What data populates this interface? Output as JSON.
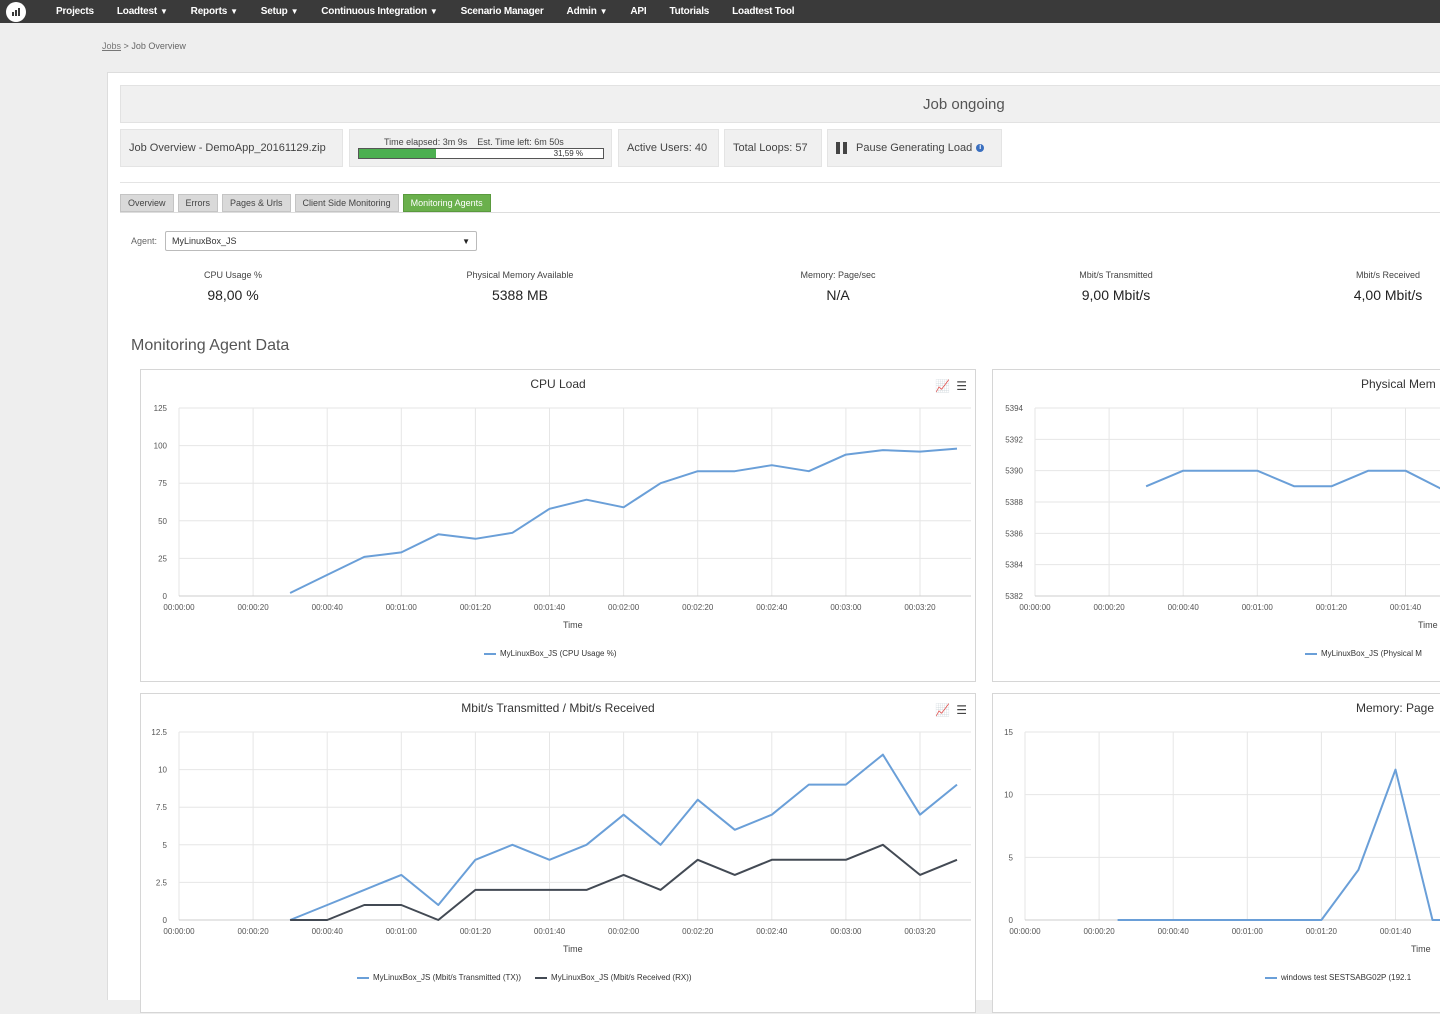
{
  "nav": {
    "items": [
      {
        "label": "Projects",
        "caret": false
      },
      {
        "label": "Loadtest",
        "caret": true
      },
      {
        "label": "Reports",
        "caret": true
      },
      {
        "label": "Setup",
        "caret": true
      },
      {
        "label": "Continuous Integration",
        "caret": true
      },
      {
        "label": "Scenario Manager",
        "caret": false
      },
      {
        "label": "Admin",
        "caret": true
      },
      {
        "label": "API",
        "caret": false
      },
      {
        "label": "Tutorials",
        "caret": false
      },
      {
        "label": "Loadtest Tool",
        "caret": false
      }
    ]
  },
  "breadcrumb": {
    "link": "Jobs",
    "separator": ">",
    "current": "Job Overview"
  },
  "status": "Job ongoing",
  "job": {
    "title": "Job Overview - DemoApp_20161129.zip",
    "elapsed": "Time elapsed: 3m 9s",
    "remaining": "Est. Time left: 6m 50s",
    "progress_percent": 31.59,
    "progress_label": "31,59 %",
    "active_users": "Active Users: 40",
    "total_loops": "Total Loops: 57",
    "pause_label": "Pause Generating Load",
    "info_glyph": "i"
  },
  "tabs": [
    {
      "label": "Overview",
      "active": false
    },
    {
      "label": "Errors",
      "active": false
    },
    {
      "label": "Pages & Urls",
      "active": false
    },
    {
      "label": "Client Side Monitoring",
      "active": false
    },
    {
      "label": "Monitoring Agents",
      "active": true
    }
  ],
  "agent": {
    "label": "Agent:",
    "selected": "MyLinuxBox_JS"
  },
  "stats": [
    {
      "label": "CPU Usage %",
      "value": "98,00 %"
    },
    {
      "label": "Physical Memory Available",
      "value": "5388 MB"
    },
    {
      "label": "Memory: Page/sec",
      "value": "N/A"
    },
    {
      "label": "Mbit/s Transmitted",
      "value": "9,00 Mbit/s"
    },
    {
      "label": "Mbit/s Received",
      "value": "4,00 Mbit/s"
    }
  ],
  "section_title": "Monitoring Agent Data",
  "colors": {
    "series1": "#6a9fd8",
    "series2": "#434a54",
    "progress": "#4caf50",
    "tab_active": "#6ab04c"
  },
  "chart_data": [
    {
      "type": "line",
      "title": "CPU Load",
      "xlabel": "Time",
      "x": [
        "00:00:00",
        "00:00:20",
        "00:00:40",
        "00:01:00",
        "00:01:20",
        "00:01:40",
        "00:02:00",
        "00:02:20",
        "00:02:40",
        "00:03:00",
        "00:03:20"
      ],
      "y_ticks": [
        "0",
        "25",
        "50",
        "75",
        "100",
        "125"
      ],
      "ylim": [
        0,
        125
      ],
      "series": [
        {
          "name": "MyLinuxBox_JS (CPU Usage %)",
          "color": "#6a9fd8",
          "points": [
            [
              30,
              2
            ],
            [
              40,
              14
            ],
            [
              50,
              26
            ],
            [
              60,
              29
            ],
            [
              70,
              41
            ],
            [
              80,
              38
            ],
            [
              90,
              42
            ],
            [
              100,
              58
            ],
            [
              110,
              64
            ],
            [
              120,
              59
            ],
            [
              130,
              75
            ],
            [
              140,
              83
            ],
            [
              150,
              83
            ],
            [
              160,
              87
            ],
            [
              170,
              83
            ],
            [
              180,
              94
            ],
            [
              190,
              97
            ],
            [
              200,
              96
            ],
            [
              210,
              98
            ]
          ]
        }
      ]
    },
    {
      "type": "line",
      "title": "Physical Mem",
      "xlabel": "Time",
      "x": [
        "00:00:00",
        "00:00:20",
        "00:00:40",
        "00:01:00",
        "00:01:20",
        "00:01:40"
      ],
      "y_ticks": [
        "5382",
        "5384",
        "5386",
        "5388",
        "5390",
        "5392",
        "5394"
      ],
      "ylim": [
        5382,
        5394
      ],
      "series": [
        {
          "name": "MyLinuxBox_JS (Physical M",
          "color": "#6a9fd8",
          "points": [
            [
              30,
              5389
            ],
            [
              40,
              5390
            ],
            [
              50,
              5390
            ],
            [
              60,
              5390
            ],
            [
              70,
              5389
            ],
            [
              80,
              5389
            ],
            [
              90,
              5390
            ],
            [
              100,
              5390
            ],
            [
              110,
              5388.8
            ]
          ]
        }
      ]
    },
    {
      "type": "line",
      "title": "Mbit/s Transmitted / Mbit/s Received",
      "xlabel": "Time",
      "x": [
        "00:00:00",
        "00:00:20",
        "00:00:40",
        "00:01:00",
        "00:01:20",
        "00:01:40",
        "00:02:00",
        "00:02:20",
        "00:02:40",
        "00:03:00",
        "00:03:20"
      ],
      "y_ticks": [
        "0",
        "2.5",
        "5",
        "7.5",
        "10",
        "12.5"
      ],
      "ylim": [
        0,
        12.5
      ],
      "series": [
        {
          "name": "MyLinuxBox_JS (Mbit/s Transmitted (TX))",
          "color": "#6a9fd8",
          "points": [
            [
              30,
              0
            ],
            [
              40,
              1
            ],
            [
              50,
              2
            ],
            [
              60,
              3
            ],
            [
              70,
              1
            ],
            [
              80,
              4
            ],
            [
              90,
              5
            ],
            [
              100,
              4
            ],
            [
              110,
              5
            ],
            [
              120,
              7
            ],
            [
              130,
              5
            ],
            [
              140,
              8
            ],
            [
              150,
              6
            ],
            [
              160,
              7
            ],
            [
              170,
              9
            ],
            [
              180,
              9
            ],
            [
              190,
              11
            ],
            [
              200,
              7
            ],
            [
              210,
              9
            ]
          ]
        },
        {
          "name": "MyLinuxBox_JS (Mbit/s Received (RX))",
          "color": "#434a54",
          "points": [
            [
              30,
              0
            ],
            [
              40,
              0
            ],
            [
              50,
              1
            ],
            [
              60,
              1
            ],
            [
              70,
              0
            ],
            [
              80,
              2
            ],
            [
              90,
              2
            ],
            [
              100,
              2
            ],
            [
              110,
              2
            ],
            [
              120,
              3
            ],
            [
              130,
              2
            ],
            [
              140,
              4
            ],
            [
              150,
              3
            ],
            [
              160,
              4
            ],
            [
              170,
              4
            ],
            [
              180,
              4
            ],
            [
              190,
              5
            ],
            [
              200,
              3
            ],
            [
              210,
              4
            ]
          ]
        }
      ]
    },
    {
      "type": "line",
      "title": "Memory: Page",
      "xlabel": "Time",
      "x": [
        "00:00:00",
        "00:00:20",
        "00:00:40",
        "00:01:00",
        "00:01:20",
        "00:01:40"
      ],
      "y_ticks": [
        "0",
        "5",
        "10",
        "15"
      ],
      "ylim": [
        0,
        15
      ],
      "series": [
        {
          "name": "windows test SESTSABG02P (192.1",
          "color": "#6a9fd8",
          "points": [
            [
              25,
              0
            ],
            [
              35,
              0
            ],
            [
              45,
              0
            ],
            [
              55,
              0
            ],
            [
              65,
              0
            ],
            [
              75,
              0
            ],
            [
              80,
              0
            ],
            [
              90,
              4
            ],
            [
              100,
              12
            ],
            [
              110,
              0
            ],
            [
              120,
              0
            ]
          ]
        }
      ]
    }
  ]
}
